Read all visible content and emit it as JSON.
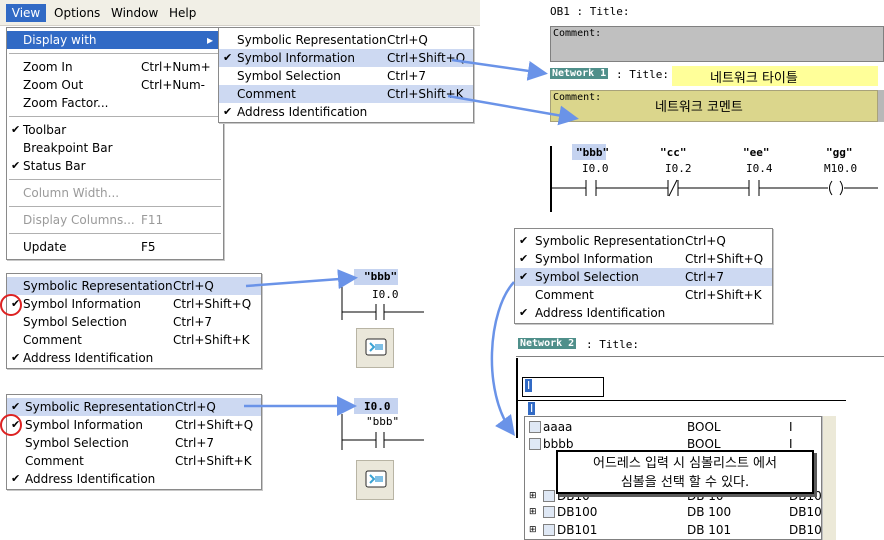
{
  "menubar": {
    "items": [
      "View",
      "Options",
      "Window",
      "Help"
    ]
  },
  "view_menu": {
    "items": [
      {
        "label": "Display with",
        "submenu_arrow": "▸",
        "highlighted": true
      },
      {
        "label": "Zoom In",
        "accel": "Ctrl+Num+"
      },
      {
        "label": "Zoom Out",
        "accel": "Ctrl+Num-"
      },
      {
        "label": "Zoom Factor..."
      },
      {
        "label": "Toolbar",
        "checked": true
      },
      {
        "label": "Breakpoint Bar"
      },
      {
        "label": "Status Bar",
        "checked": true
      },
      {
        "label": "Column Width...",
        "disabled": true
      },
      {
        "label": "Display Columns...",
        "accel": "F11",
        "disabled": true
      },
      {
        "label": "Update",
        "accel": "F5"
      }
    ]
  },
  "display_submenu": {
    "items": [
      {
        "label": "Symbolic Representation",
        "accel": "Ctrl+Q"
      },
      {
        "label": "Symbol Information",
        "accel": "Ctrl+Shift+Q",
        "checked": true,
        "highlighted": true
      },
      {
        "label": "Symbol Selection",
        "accel": "Ctrl+7"
      },
      {
        "label": "Comment",
        "accel": "Ctrl+Shift+K",
        "highlighted": true
      },
      {
        "label": "Address Identification",
        "checked": true
      }
    ]
  },
  "menu_left_a": {
    "items": [
      {
        "label": "Symbolic Representation",
        "accel": "Ctrl+Q"
      },
      {
        "label": "Symbol Information",
        "accel": "Ctrl+Shift+Q",
        "checked": true
      },
      {
        "label": "Symbol Selection",
        "accel": "Ctrl+7"
      },
      {
        "label": "Comment",
        "accel": "Ctrl+Shift+K"
      },
      {
        "label": "Address Identification",
        "checked": true
      }
    ]
  },
  "menu_left_b": {
    "items": [
      {
        "label": "Symbolic Representation",
        "accel": "Ctrl+Q",
        "checked": true
      },
      {
        "label": "Symbol Information",
        "accel": "Ctrl+Shift+Q",
        "checked": true
      },
      {
        "label": "Symbol Selection",
        "accel": "Ctrl+7"
      },
      {
        "label": "Comment",
        "accel": "Ctrl+Shift+K"
      },
      {
        "label": "Address Identification",
        "checked": true
      }
    ]
  },
  "menu_right": {
    "items": [
      {
        "label": "Symbolic Representation",
        "accel": "Ctrl+Q",
        "checked": true
      },
      {
        "label": "Symbol Information",
        "accel": "Ctrl+Shift+Q",
        "checked": true
      },
      {
        "label": "Symbol Selection",
        "accel": "Ctrl+7",
        "checked": true
      },
      {
        "label": "Comment",
        "accel": "Ctrl+Shift+K"
      },
      {
        "label": "Address Identification",
        "checked": true
      }
    ]
  },
  "editor": {
    "ob_title": "OB1 : Title:",
    "comment_label": "Comment:",
    "network1_label": "Network 1",
    "network1_title_prefix": ": Title:",
    "network_title_korean": "네트워크 타이틀",
    "network_comment_korean": "네트워크 코멘트",
    "contacts": [
      {
        "symbol": "\"bbb\"",
        "address": "I0.0",
        "type": "NO"
      },
      {
        "symbol": "\"cc\"",
        "address": "I0.2",
        "type": "NC"
      },
      {
        "symbol": "\"ee\"",
        "address": "I0.4",
        "type": "NO"
      },
      {
        "symbol": "\"gg\"",
        "address": "M10.0",
        "type": "coil"
      }
    ]
  },
  "mini_a": {
    "symbol": "\"bbb\"",
    "address": "I0.0"
  },
  "mini_b": {
    "address": "I0.0",
    "symbol": "\"bbb\""
  },
  "network2": {
    "label": "Network 2",
    "title": ": Title:",
    "input_value": "I",
    "list_rows": [
      {
        "name": "aaaa",
        "type": "BOOL",
        "addr": "I"
      },
      {
        "name": "bbbb",
        "type": "BOOL",
        "addr": "I"
      },
      {
        "name": "DB10",
        "type": "DB  10",
        "addr": "DB10"
      },
      {
        "name": "DB100",
        "type": "DB  100",
        "addr": "DB100"
      },
      {
        "name": "DB101",
        "type": "DB  101",
        "addr": "DB101"
      }
    ]
  },
  "callout": {
    "line1": "어드레스 입력 시 심볼리스트 에서",
    "line2": "심볼을 선택 할 수 있다."
  },
  "colors": {
    "menu_highlight": "#316ac5",
    "light_highlight": "#cdd9f2",
    "arrow": "#6a93e8",
    "network_title_bg": "#ffff99",
    "network_comment_bg": "#dbd68c",
    "network_label_bg": "#4f8f8a"
  }
}
